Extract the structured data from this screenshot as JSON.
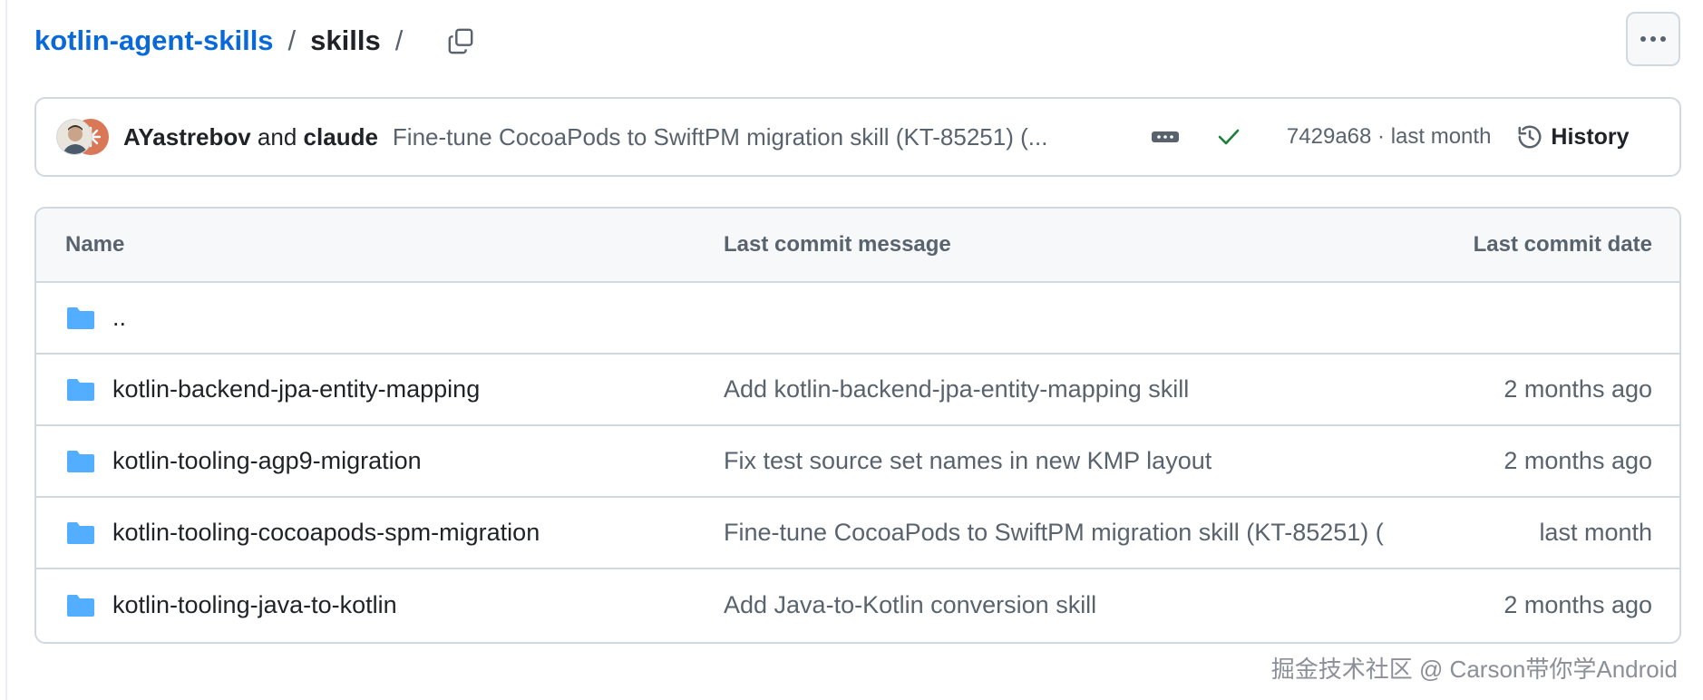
{
  "breadcrumb": {
    "repo": "kotlin-agent-skills",
    "separator": "/",
    "current": "skills",
    "trailing_separator": "/"
  },
  "icons": {
    "copy": "copy-icon",
    "more": "kebab-horizontal-icon",
    "expand": "ellipsis-icon",
    "check": "check-icon",
    "history": "history-icon",
    "folder": "folder-icon"
  },
  "colors": {
    "link": "#0969da",
    "folder": "#54aeff",
    "success": "#1a7f37",
    "muted": "#59636e",
    "border": "#d1d9e0"
  },
  "latest_commit": {
    "author_1": "AYastrebov",
    "conjunction": "and",
    "author_2": "claude",
    "message": "Fine-tune CocoaPods to SwiftPM migration skill (KT-85251) (...",
    "status": "success",
    "sha": "7429a68",
    "dot": "·",
    "time": "last month",
    "history_label": "History"
  },
  "table": {
    "headers": {
      "name": "Name",
      "message": "Last commit message",
      "date": "Last commit date"
    },
    "parent_dir": "..",
    "rows": [
      {
        "name": "kotlin-backend-jpa-entity-mapping",
        "message": "Add kotlin-backend-jpa-entity-mapping skill",
        "date": "2 months ago"
      },
      {
        "name": "kotlin-tooling-agp9-migration",
        "message": "Fix test source set names in new KMP layout",
        "date": "2 months ago"
      },
      {
        "name": "kotlin-tooling-cocoapods-spm-migration",
        "message": "Fine-tune CocoaPods to SwiftPM migration skill (KT-85251) (",
        "date": "last month"
      },
      {
        "name": "kotlin-tooling-java-to-kotlin",
        "message": "Add Java-to-Kotlin conversion skill",
        "date": "2 months ago"
      }
    ]
  },
  "watermark": "掘金技术社区 @ Carson带你学Android"
}
